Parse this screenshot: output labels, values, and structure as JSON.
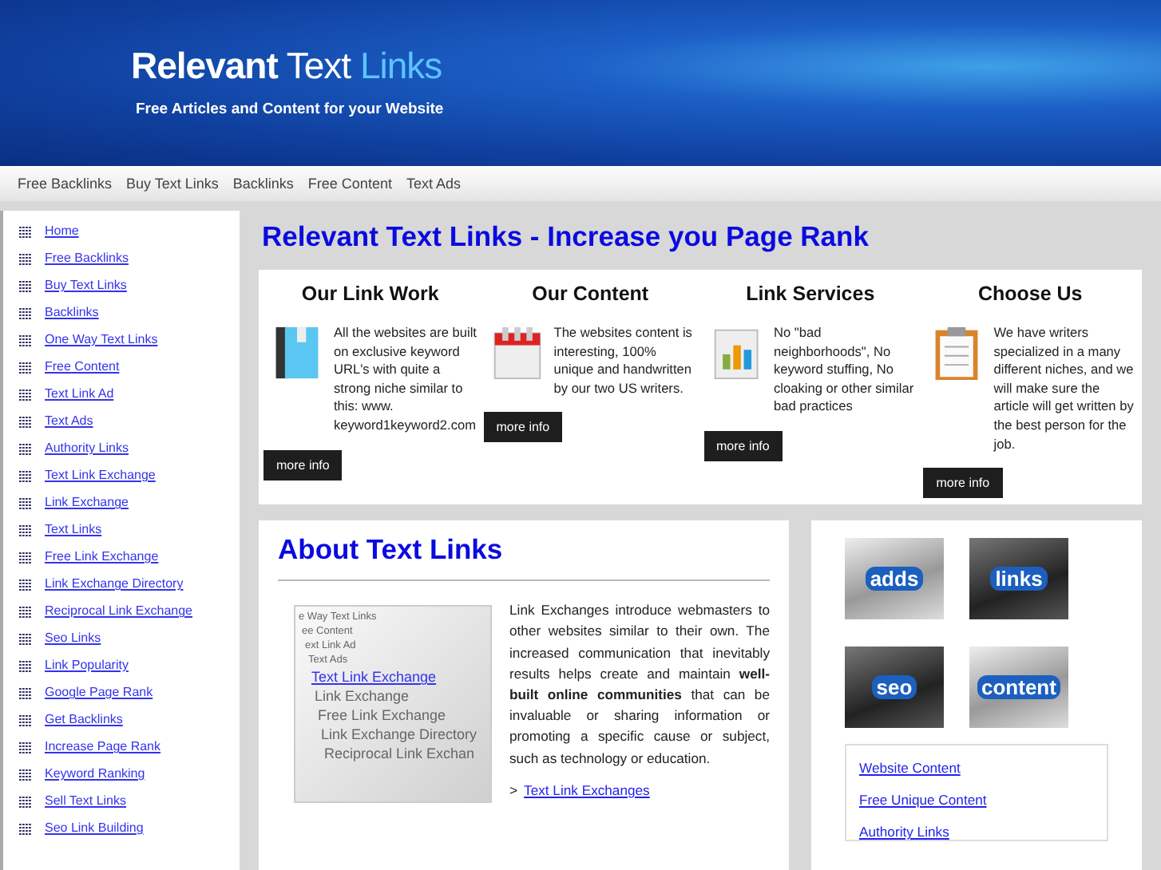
{
  "header": {
    "logo": {
      "bold": "Relevant",
      "light": "Text",
      "accent": "Links"
    },
    "tagline": "Free Articles and Content for your Website"
  },
  "nav": [
    "Free Backlinks",
    "Buy Text Links",
    "Backlinks",
    "Free Content",
    "Text Ads"
  ],
  "sidebar": {
    "items": [
      "Home",
      "Free Backlinks",
      "Buy Text Links",
      "Backlinks",
      "One Way Text Links",
      "Free Content",
      "Text Link Ad",
      "Text Ads",
      "Authority Links",
      "Text Link Exchange",
      "Link Exchange",
      "Text Links",
      "Free Link Exchange",
      "Link Exchange Directory",
      "Reciprocal Link Exchange",
      "Seo Links",
      "Link Popularity",
      "Google Page Rank",
      "Get Backlinks",
      "Increase Page Rank",
      "Keyword Ranking",
      "Sell Text Links",
      "Seo Link Building"
    ]
  },
  "page_title": "Relevant Text Links - Increase you Page Rank",
  "features": [
    {
      "title": "Our Link Work",
      "text": "All the websites are built on exclusive keyword URL's with quite a strong niche similar to this: www. keyword1keyword2.com",
      "button": "more info"
    },
    {
      "title": "Our Content",
      "text": "The websites content is interesting, 100% unique and handwritten by our two US writers.",
      "button": "more info"
    },
    {
      "title": "Link Services",
      "text": "No \"bad neighborhoods\", No keyword stuffing, No cloaking or other similar bad practices",
      "button": "more info"
    },
    {
      "title": "Choose Us",
      "text": "We have writers specialized in a many different niches, and we will make sure the article will get written by the best person for the job.",
      "button": "more info"
    }
  ],
  "about": {
    "title": "About Text Links",
    "image_lines": [
      "e Way Text Links",
      "ee Content",
      "ext Link Ad",
      "Text Ads",
      "Text Link Exchange",
      "Link Exchange",
      "Free Link Exchange",
      "Link Exchange Directory",
      "Reciprocal Link Exchan"
    ],
    "text": "Link Exchanges introduce webmasters to other websites similar to their own. The increased communication that inevitably results helps create and maintain **well-built online communities** that can be invaluable or sharing information or promoting a specific cause or subject, such as technology or education.",
    "link_prefix": ">",
    "link": "Text Link Exchanges"
  },
  "tiles": [
    {
      "label": "adds"
    },
    {
      "label": "links"
    },
    {
      "label": "seo"
    },
    {
      "label": "content"
    }
  ],
  "side_links": [
    "Website Content",
    "Free Unique Content",
    "Authority Links"
  ]
}
